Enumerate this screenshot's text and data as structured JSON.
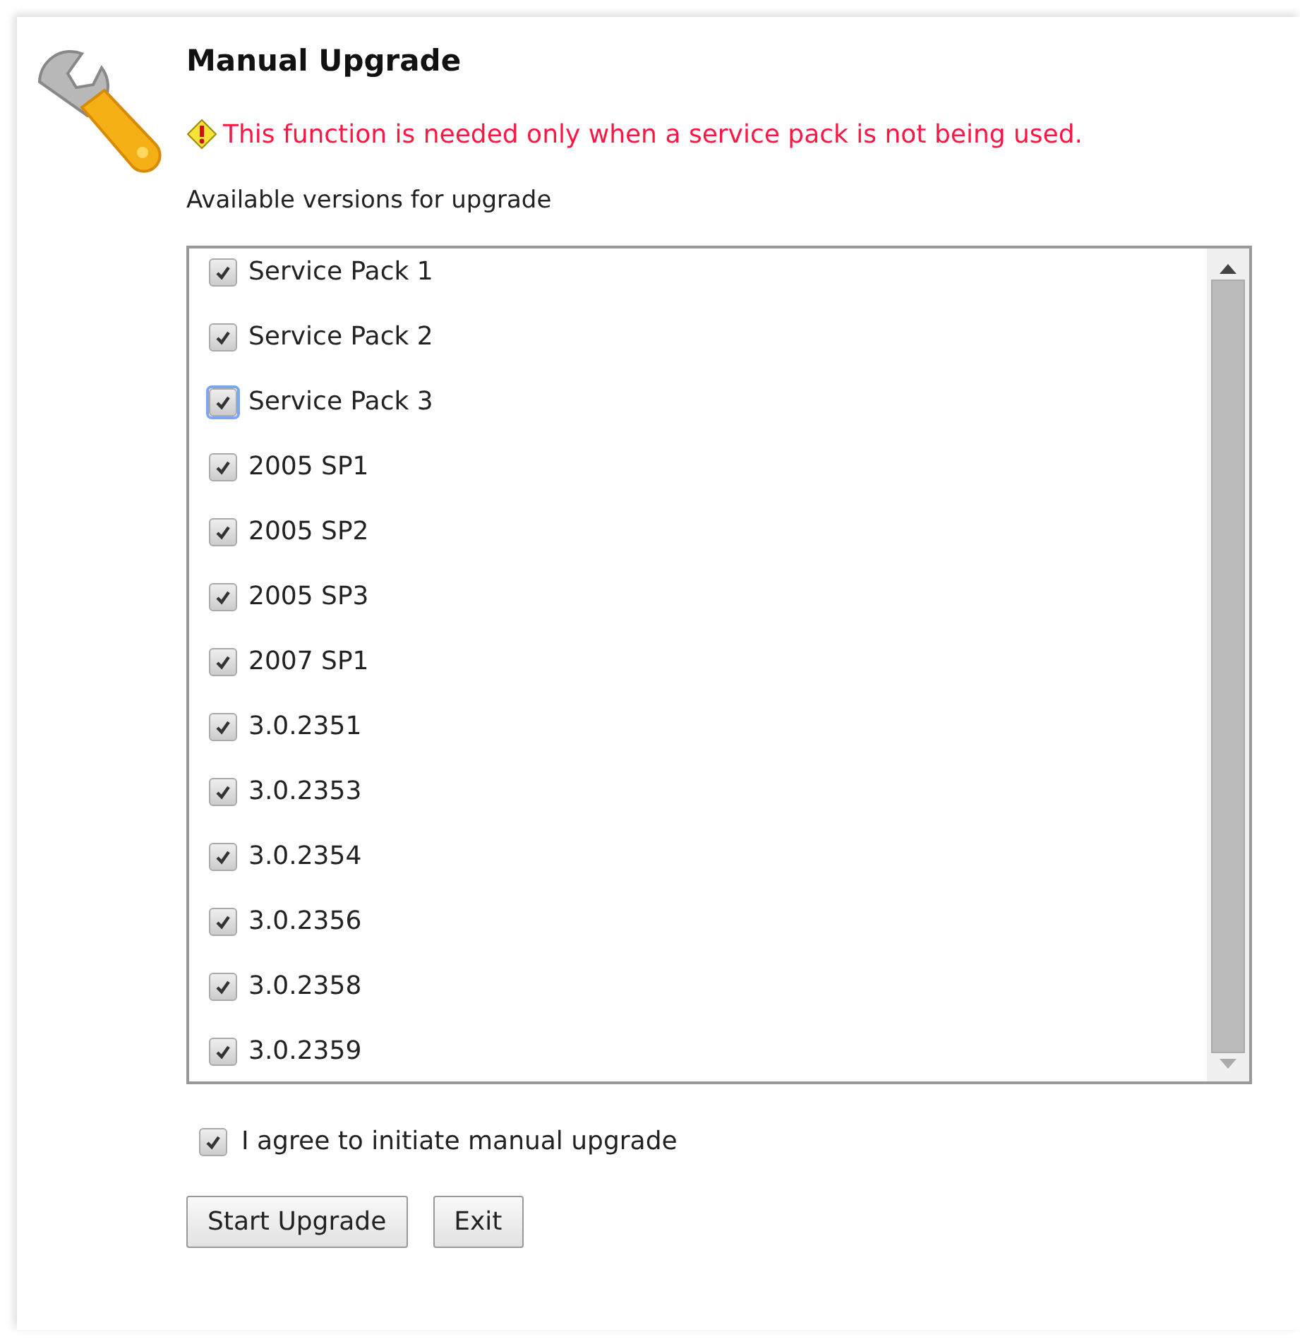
{
  "title": "Manual Upgrade",
  "warning": "This function is needed only when a service pack is not being used.",
  "list_label": "Available versions for upgrade",
  "versions": [
    {
      "label": "Service Pack 1",
      "checked": true,
      "focused": false
    },
    {
      "label": "Service Pack 2",
      "checked": true,
      "focused": false
    },
    {
      "label": "Service Pack 3",
      "checked": true,
      "focused": true
    },
    {
      "label": "2005 SP1",
      "checked": true,
      "focused": false
    },
    {
      "label": "2005 SP2",
      "checked": true,
      "focused": false
    },
    {
      "label": "2005 SP3",
      "checked": true,
      "focused": false
    },
    {
      "label": "2007 SP1",
      "checked": true,
      "focused": false
    },
    {
      "label": "3.0.2351",
      "checked": true,
      "focused": false
    },
    {
      "label": "3.0.2353",
      "checked": true,
      "focused": false
    },
    {
      "label": "3.0.2354",
      "checked": true,
      "focused": false
    },
    {
      "label": "3.0.2356",
      "checked": true,
      "focused": false
    },
    {
      "label": "3.0.2358",
      "checked": true,
      "focused": false
    },
    {
      "label": "3.0.2359",
      "checked": true,
      "focused": false
    }
  ],
  "agree": {
    "label": "I agree to initiate manual upgrade",
    "checked": true
  },
  "buttons": [
    "Start Upgrade",
    "Exit"
  ]
}
